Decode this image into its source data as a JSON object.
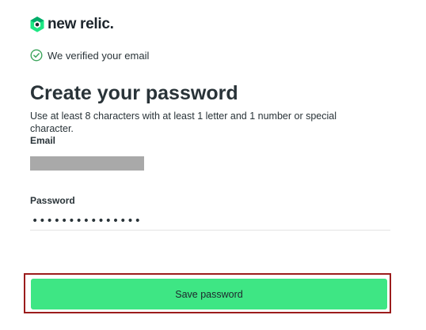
{
  "brand": {
    "logo_icon": "new-relic-logo-icon",
    "name": "new relic.",
    "accent": "#00ac69"
  },
  "status": {
    "icon": "check-circle-icon",
    "text": "We verified your email",
    "color": "#3ca55c"
  },
  "form": {
    "title": "Create your password",
    "hint": "Use at least 8 characters with at least 1 letter and 1 number or special character.",
    "email": {
      "label": "Email",
      "value_redacted": true
    },
    "password": {
      "label": "Password",
      "value": "•••••••••••••••"
    },
    "submit": {
      "label": "Save password",
      "color": "#3ee684",
      "highlight_color": "#9b1c1c"
    }
  }
}
